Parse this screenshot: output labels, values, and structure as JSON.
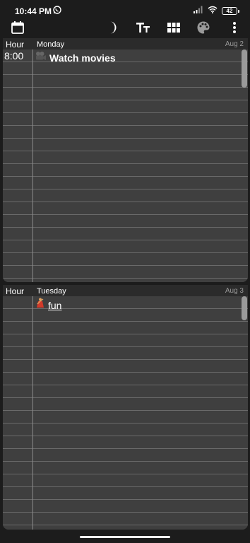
{
  "status_bar": {
    "time": "10:44 PM",
    "battery": "42"
  },
  "toolbar": {
    "icons": [
      "calendar-icon",
      "moon-icon",
      "text-size-icon",
      "grid-icon",
      "palette-icon",
      "more-vert-icon"
    ]
  },
  "days": [
    {
      "hour_header": "Hour",
      "day_name": "Monday",
      "date": "Aug 2",
      "events": [
        {
          "time": "8:00",
          "icon": "film-camera-icon",
          "title": "Watch movies"
        }
      ]
    },
    {
      "hour_header": "Hour",
      "day_name": "Tuesday",
      "date": "Aug 3",
      "events": [
        {
          "time": "",
          "icon": "dancer-icon",
          "title": "fun"
        }
      ]
    }
  ]
}
